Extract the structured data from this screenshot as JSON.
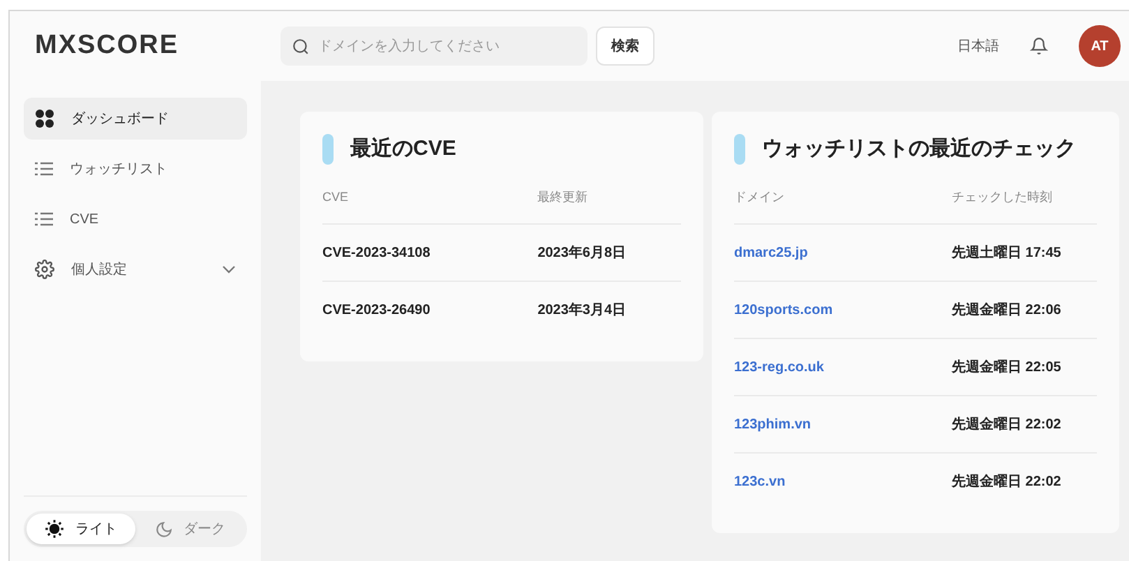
{
  "logo": "MXSCORE",
  "search": {
    "placeholder": "ドメインを入力してください",
    "button": "検索"
  },
  "header": {
    "language": "日本語",
    "avatar": "AT"
  },
  "sidebar": {
    "items": [
      {
        "label": "ダッシュボード",
        "kind": "grid",
        "selected": true
      },
      {
        "label": "ウォッチリスト",
        "kind": "list",
        "selected": false
      },
      {
        "label": "CVE",
        "kind": "list",
        "selected": false
      },
      {
        "label": "個人設定",
        "kind": "gear",
        "selected": false,
        "expanded": false
      }
    ]
  },
  "theme": [
    {
      "label": "ライト",
      "kind": "sun",
      "selected": true
    },
    {
      "label": "ダーク",
      "kind": "moon",
      "selected": false
    }
  ],
  "cve_card": {
    "title": "最近のCVE",
    "columns": [
      "CVE",
      "最終更新"
    ],
    "rows": [
      [
        "CVE-2023-34108",
        "2023年6月8日"
      ],
      [
        "CVE-2023-26490",
        "2023年3月4日"
      ]
    ]
  },
  "watch_card": {
    "title": "ウォッチリストの最近のチェック",
    "columns": [
      "ドメイン",
      "チェックした時刻"
    ],
    "rows": [
      [
        "dmarc25.jp",
        "先週土曜日 17:45"
      ],
      [
        "120sports.com",
        "先週金曜日 22:06"
      ],
      [
        "123-reg.co.uk",
        "先週金曜日 22:05"
      ],
      [
        "123phim.vn",
        "先週金曜日 22:02"
      ],
      [
        "123c.vn",
        "先週金曜日 22:02"
      ]
    ]
  }
}
